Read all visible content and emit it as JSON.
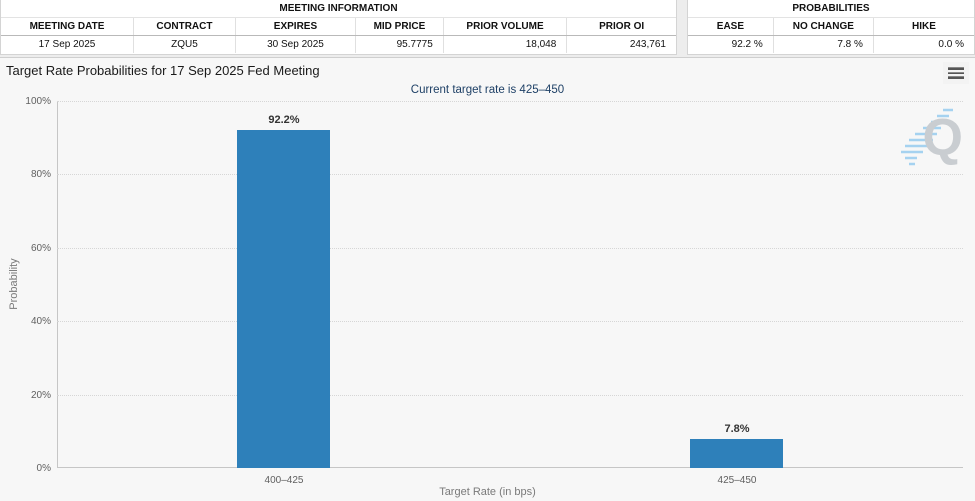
{
  "meeting_info": {
    "title": "MEETING INFORMATION",
    "columns": [
      {
        "label": "MEETING DATE",
        "value": "17 Sep 2025"
      },
      {
        "label": "CONTRACT",
        "value": "ZQU5"
      },
      {
        "label": "EXPIRES",
        "value": "30 Sep 2025"
      },
      {
        "label": "MID PRICE",
        "value": "95.7775"
      },
      {
        "label": "PRIOR VOLUME",
        "value": "18,048"
      },
      {
        "label": "PRIOR OI",
        "value": "243,761"
      }
    ]
  },
  "probabilities": {
    "title": "PROBABILITIES",
    "columns": [
      {
        "label": "EASE",
        "value": "92.2 %"
      },
      {
        "label": "NO CHANGE",
        "value": "7.8 %"
      },
      {
        "label": "HIKE",
        "value": "0.0 %"
      }
    ]
  },
  "chart": {
    "title": "Target Rate Probabilities for 17 Sep 2025 Fed Meeting",
    "subtitle": "Current target rate is 425–450",
    "watermark_letter": "Q",
    "menu_icon": "hamburger-icon"
  },
  "chart_data": {
    "type": "bar",
    "categories": [
      "400–425",
      "425–450"
    ],
    "values": [
      92.2,
      7.8
    ],
    "value_labels": [
      "92.2%",
      "7.8%"
    ],
    "title": "Target Rate Probabilities for 17 Sep 2025 Fed Meeting",
    "subtitle": "Current target rate is 425–450",
    "xlabel": "Target Rate (in bps)",
    "ylabel": "Probability",
    "ylim": [
      0,
      100
    ],
    "yticks": [
      "0%",
      "20%",
      "40%",
      "60%",
      "80%",
      "100%"
    ],
    "grid": "horizontal-dotted",
    "legend": "none",
    "bar_color": "#2e80ba",
    "colors": {
      "subtitle": "#1e4066",
      "tick_text": "#606060",
      "axis_title": "#7a7a7a",
      "grid": "#d6d6d6"
    }
  }
}
